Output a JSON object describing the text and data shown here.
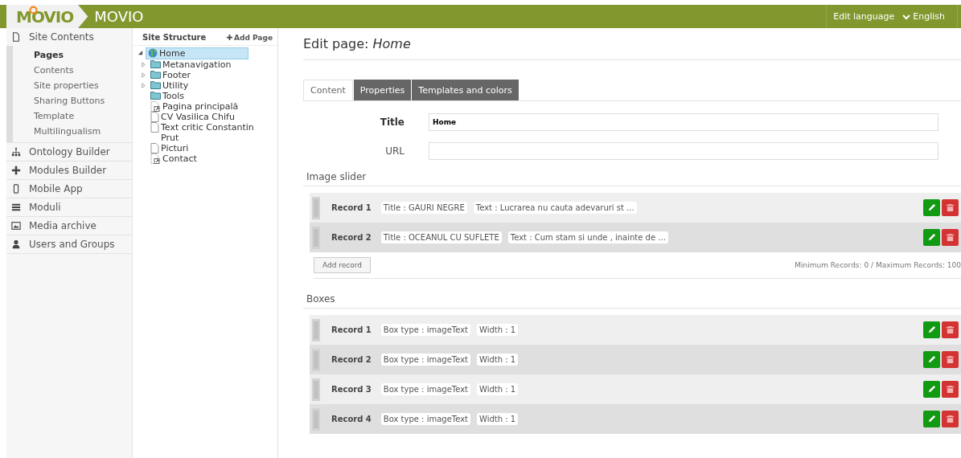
{
  "topbar": {
    "logo": "MOVIO",
    "app_title": "MOVIO",
    "edit_language_label": "Edit language",
    "language": "English"
  },
  "sidebar": {
    "sections": [
      {
        "label": "Site Contents",
        "children": [
          {
            "label": "Pages",
            "selected": true
          },
          {
            "label": "Contents",
            "selected": false
          },
          {
            "label": "Site properties",
            "selected": false
          },
          {
            "label": "Sharing Buttons",
            "selected": false
          },
          {
            "label": "Template",
            "selected": false
          },
          {
            "label": "Multilingualism",
            "selected": false
          }
        ]
      },
      {
        "label": "Ontology Builder"
      },
      {
        "label": "Modules Builder"
      },
      {
        "label": "Mobile App"
      },
      {
        "label": "Moduli"
      },
      {
        "label": "Media archive"
      },
      {
        "label": "Users and Groups"
      }
    ]
  },
  "site_structure": {
    "title": "Site Structure",
    "add_button": "Add Page",
    "tree": [
      {
        "label": "Home",
        "kind": "home",
        "selected": true,
        "expanded": true,
        "children": [
          {
            "label": "Metanavigation",
            "kind": "folder",
            "selected": false,
            "expanded": false
          },
          {
            "label": "Footer",
            "kind": "folder",
            "selected": false,
            "expanded": false
          },
          {
            "label": "Utility",
            "kind": "folder",
            "selected": false,
            "expanded": false
          },
          {
            "label": "Tools",
            "kind": "empty-folder",
            "selected": false
          },
          {
            "label": "Pagina principală",
            "kind": "linked-page",
            "selected": false
          },
          {
            "label": "CV Vasilica Chifu",
            "kind": "page",
            "selected": false
          },
          {
            "label": "Text critic Constantin Prut",
            "kind": "page",
            "selected": false
          },
          {
            "label": "Picturi",
            "kind": "page",
            "selected": false
          },
          {
            "label": "Contact",
            "kind": "linked-page",
            "selected": false
          }
        ]
      }
    ]
  },
  "editor": {
    "heading": "Edit page:",
    "page_name": "Home",
    "tabs": [
      {
        "label": "Content",
        "selected": true
      },
      {
        "label": "Properties",
        "selected": false
      },
      {
        "label": "Templates and colors",
        "selected": false
      }
    ],
    "fields": [
      {
        "label": "Title",
        "value": "Home"
      },
      {
        "label": "URL"
      }
    ],
    "sections": [
      {
        "title": "Image slider",
        "records": [
          {
            "label": "Record 1",
            "chips": [
              "Title : GAURI NEGRE",
              "Text : Lucrarea nu cauta adevaruri st ..."
            ]
          },
          {
            "label": "Record 2",
            "chips": [
              "Title : OCEANUL CU SUFLETE",
              "Text : Cum stam si unde , inainte de ..."
            ]
          }
        ],
        "add_button": "Add record",
        "limits": "Minimum Records: 0 / Maximum Records: 100"
      },
      {
        "title": "Boxes",
        "records": [
          {
            "label": "Record 1",
            "chips": [
              "Box type : imageText",
              "Width : 1"
            ]
          },
          {
            "label": "Record 2",
            "chips": [
              "Box type : imageText",
              "Width : 1"
            ]
          },
          {
            "label": "Record 3",
            "chips": [
              "Box type : imageText",
              "Width : 1"
            ]
          },
          {
            "label": "Record 4",
            "chips": [
              "Box type : imageText",
              "Width : 1"
            ]
          }
        ]
      }
    ]
  }
}
